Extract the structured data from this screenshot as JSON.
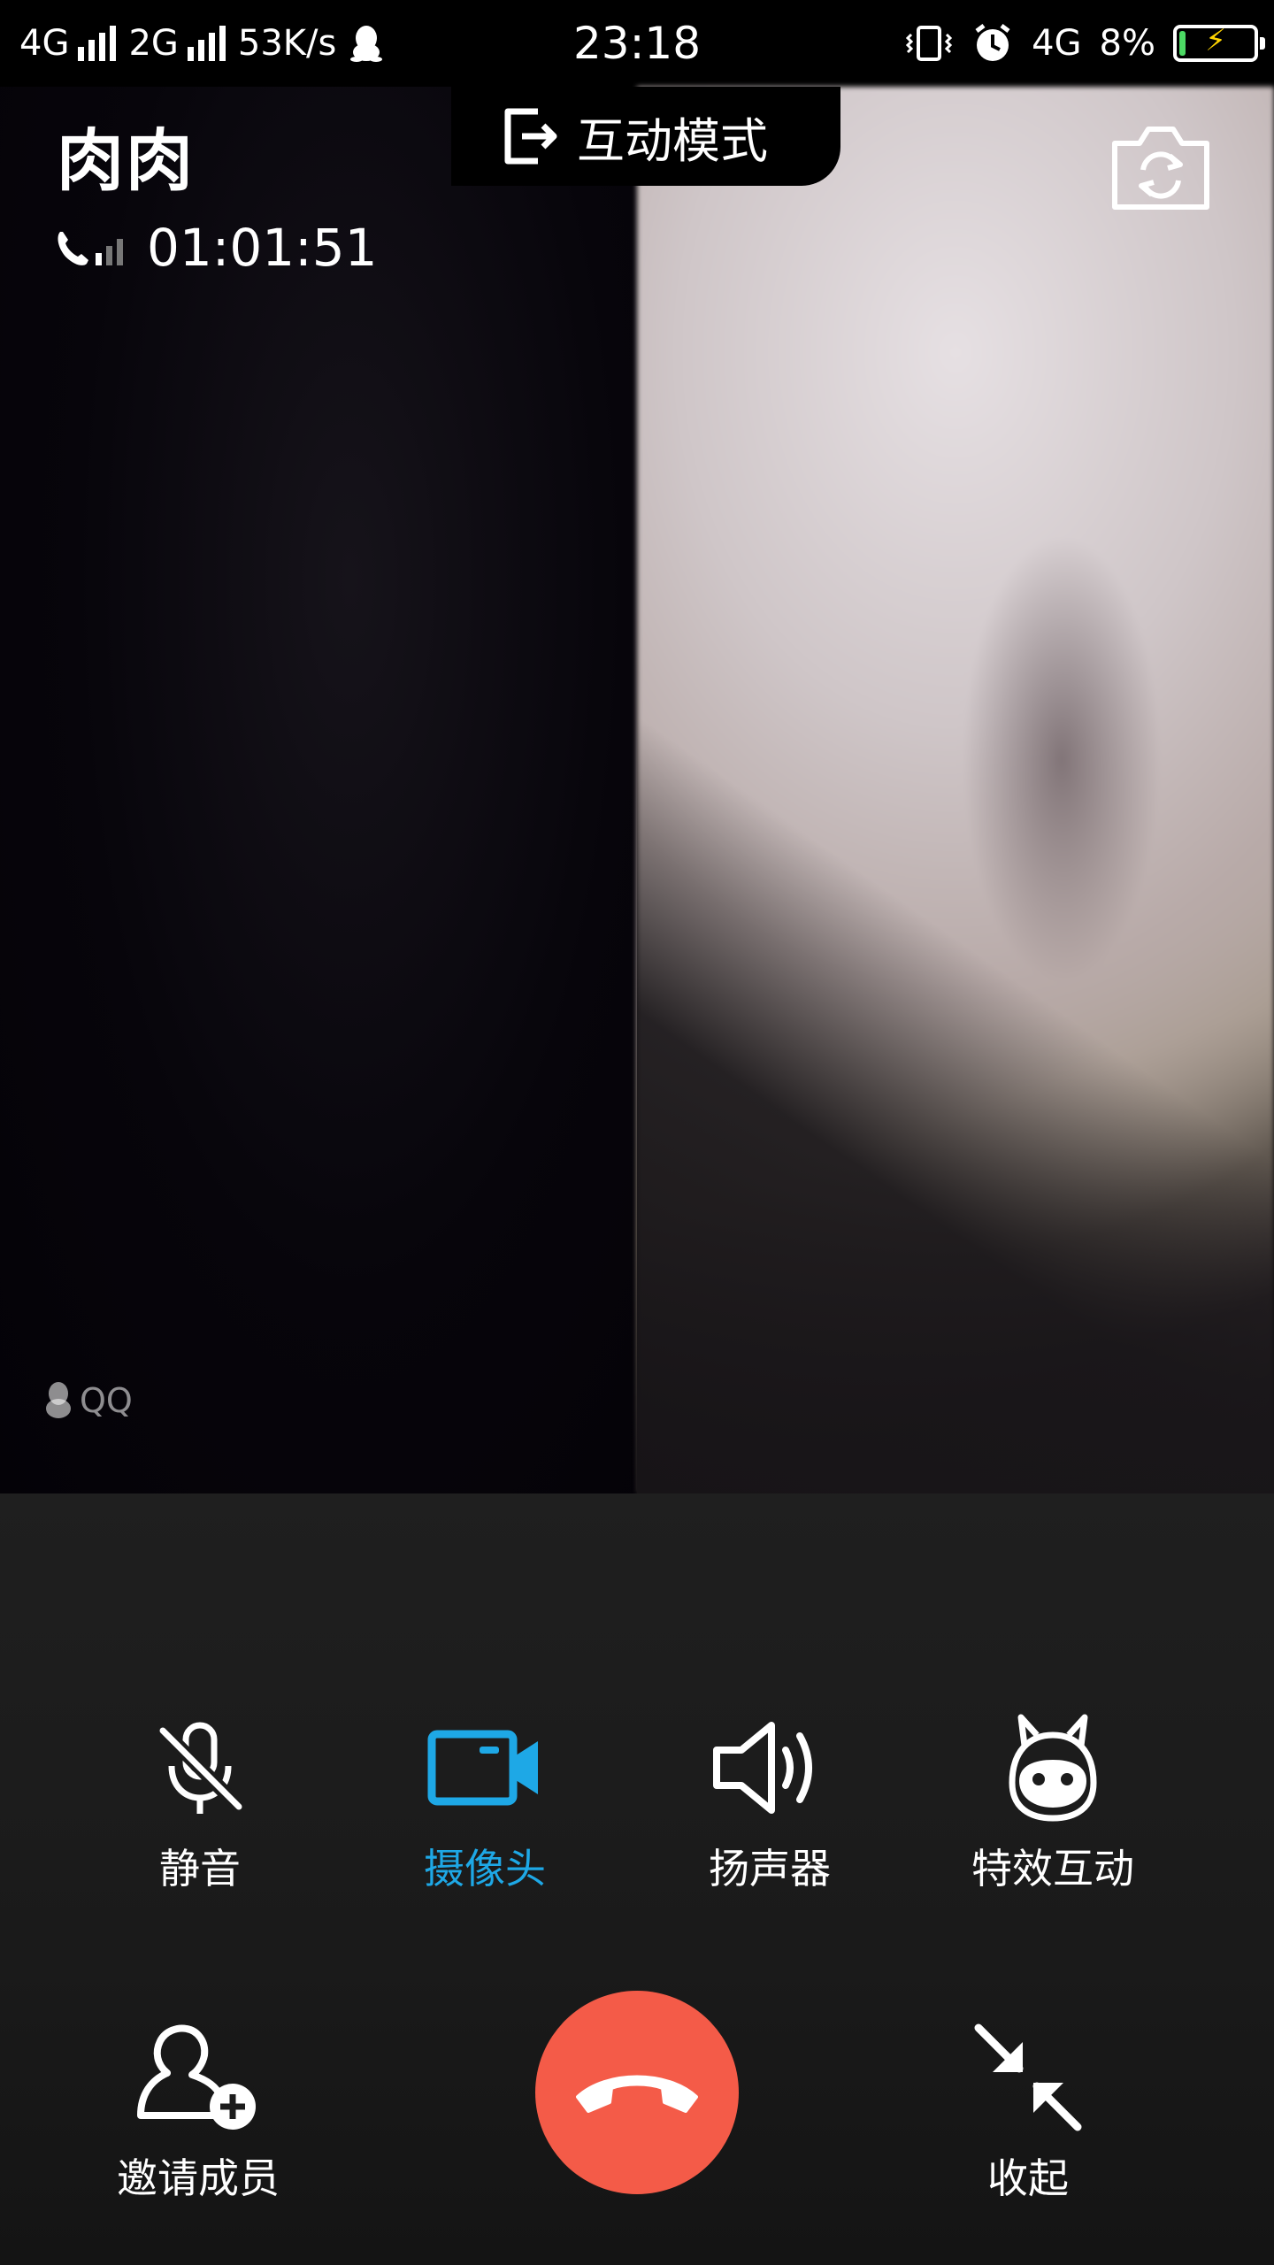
{
  "status_bar": {
    "network_1": "4G",
    "network_2": "2G",
    "speed": "53K/s",
    "time": "23:18",
    "mobile_data": "4G",
    "battery_percent": "8%",
    "battery_level": 0.08,
    "battery_color": "#4cd964"
  },
  "call": {
    "caller_name": "肉肉",
    "duration": "01:01:51",
    "mode_label": "互动模式",
    "watermark": "QQ"
  },
  "controls": {
    "mute_label": "静音",
    "camera_label": "摄像头",
    "speaker_label": "扬声器",
    "effects_label": "特效互动",
    "invite_label": "邀请成员",
    "collapse_label": "收起"
  },
  "colors": {
    "accent": "#1ea8e6",
    "hangup": "#f45b48",
    "panel": "#1c1c1c"
  }
}
